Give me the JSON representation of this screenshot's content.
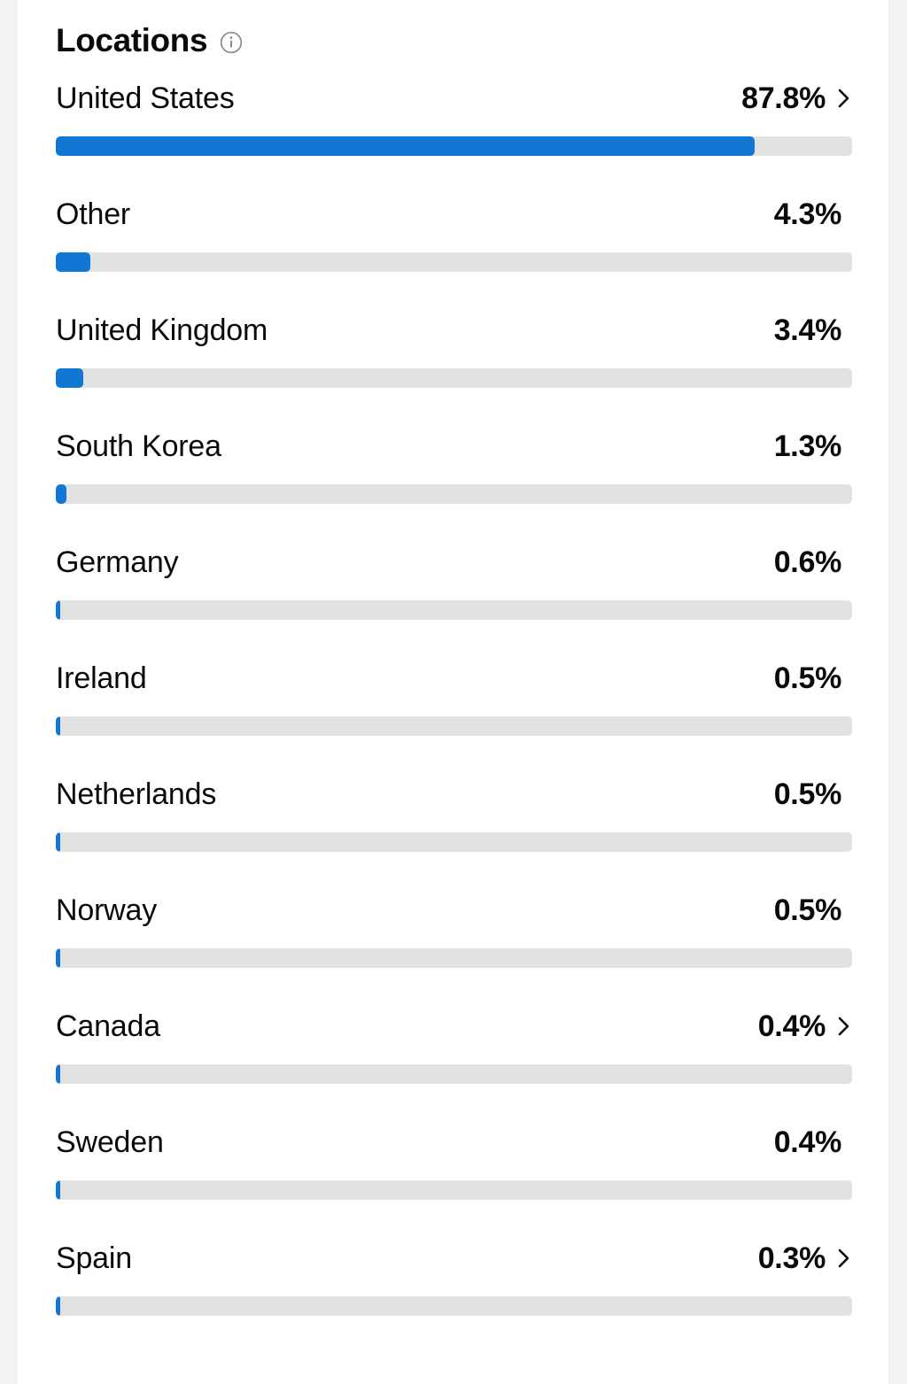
{
  "header": {
    "title": "Locations",
    "info_icon": "info-circle-icon"
  },
  "colors": {
    "bar_fill": "#1177d4",
    "bar_track": "#e2e2e2",
    "text": "#0a0a0a",
    "page_background": "#f2f2f2",
    "card_background": "#ffffff",
    "info_icon": "#8c8c8c"
  },
  "chart_data": {
    "type": "bar",
    "title": "Locations",
    "xlabel": "",
    "ylabel": "",
    "orientation": "horizontal",
    "unit": "%",
    "axis_max": 100,
    "grid": false,
    "legend": null,
    "categories": [
      "United States",
      "Other",
      "United Kingdom",
      "South Korea",
      "Germany",
      "Ireland",
      "Netherlands",
      "Norway",
      "Canada",
      "Sweden",
      "Spain"
    ],
    "values": [
      87.8,
      4.3,
      3.4,
      1.3,
      0.6,
      0.5,
      0.5,
      0.5,
      0.4,
      0.4,
      0.3
    ],
    "value_labels": [
      "87.8%",
      "4.3%",
      "3.4%",
      "1.3%",
      "0.6%",
      "0.5%",
      "0.5%",
      "0.5%",
      "0.4%",
      "0.4%",
      "0.3%"
    ]
  },
  "rows": [
    {
      "label": "United States",
      "value": "87.8%",
      "pct": 87.8,
      "chevron": true
    },
    {
      "label": "Other",
      "value": "4.3%",
      "pct": 4.3,
      "chevron": false
    },
    {
      "label": "United Kingdom",
      "value": "3.4%",
      "pct": 3.4,
      "chevron": false
    },
    {
      "label": "South Korea",
      "value": "1.3%",
      "pct": 1.3,
      "chevron": false
    },
    {
      "label": "Germany",
      "value": "0.6%",
      "pct": 0.6,
      "chevron": false
    },
    {
      "label": "Ireland",
      "value": "0.5%",
      "pct": 0.5,
      "chevron": false
    },
    {
      "label": "Netherlands",
      "value": "0.5%",
      "pct": 0.5,
      "chevron": false
    },
    {
      "label": "Norway",
      "value": "0.5%",
      "pct": 0.5,
      "chevron": false
    },
    {
      "label": "Canada",
      "value": "0.4%",
      "pct": 0.4,
      "chevron": true
    },
    {
      "label": "Sweden",
      "value": "0.4%",
      "pct": 0.4,
      "chevron": false
    },
    {
      "label": "Spain",
      "value": "0.3%",
      "pct": 0.3,
      "chevron": true
    }
  ]
}
